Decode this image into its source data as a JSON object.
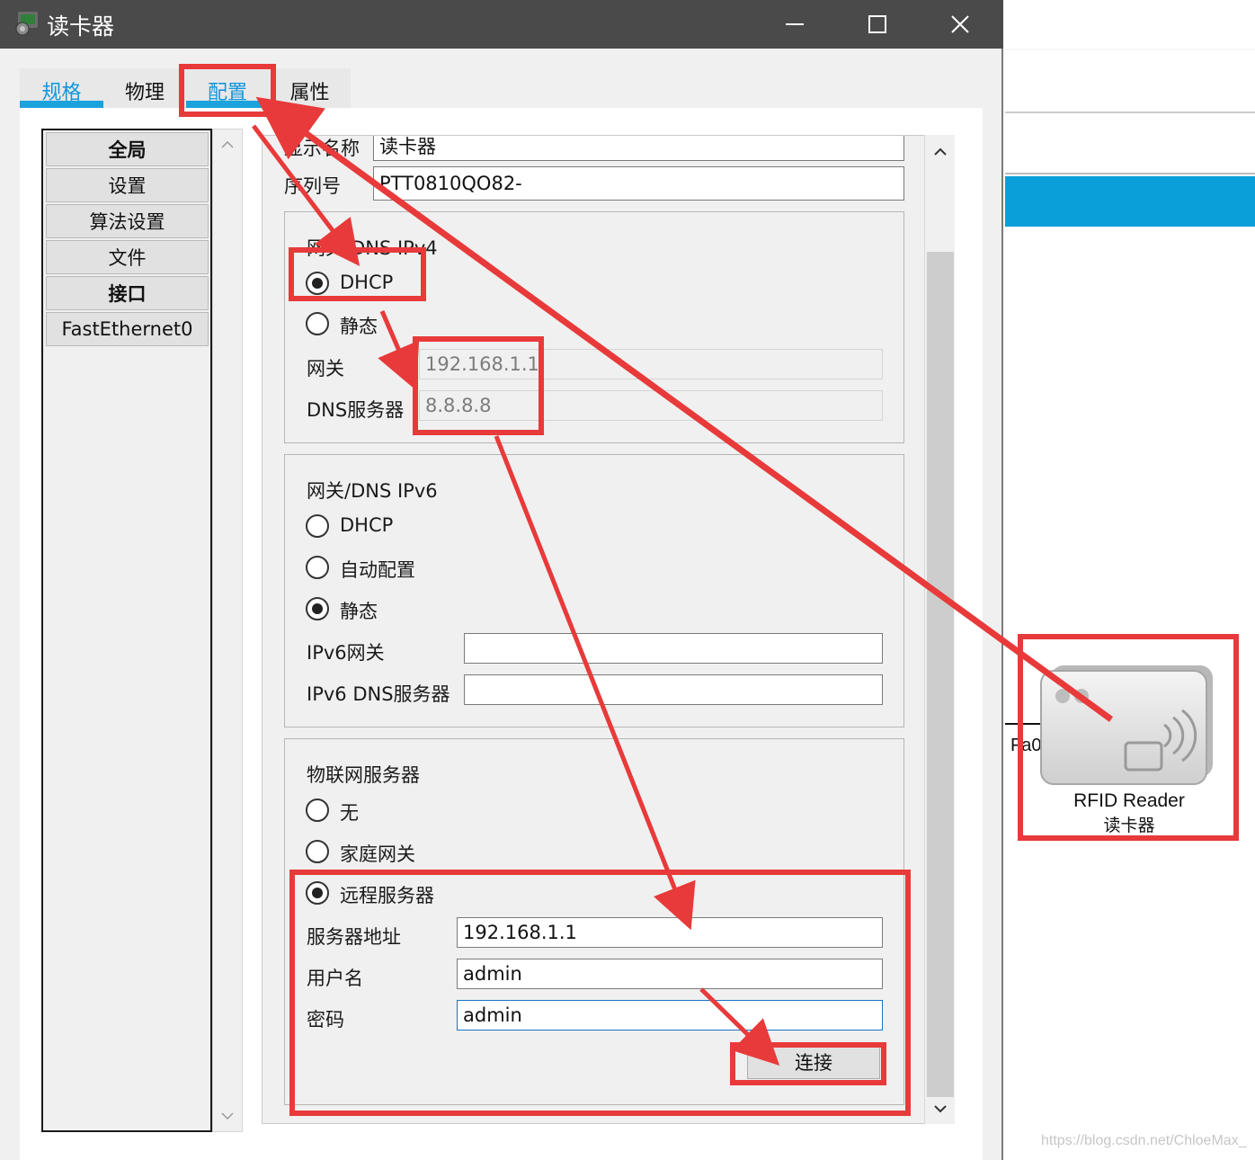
{
  "window": {
    "title": "读卡器",
    "minimize_icon": "minimize-icon",
    "maximize_icon": "maximize-icon",
    "close_icon": "close-icon"
  },
  "tabs": [
    {
      "label": "规格",
      "active": false
    },
    {
      "label": "物理",
      "active": false
    },
    {
      "label": "配置",
      "active": true
    },
    {
      "label": "属性",
      "active": false
    }
  ],
  "nav": {
    "items": [
      {
        "label": "全局",
        "bold": true
      },
      {
        "label": "设置",
        "bold": false
      },
      {
        "label": "算法设置",
        "bold": false
      },
      {
        "label": "文件",
        "bold": false
      },
      {
        "label": "接口",
        "bold": true
      },
      {
        "label": "FastEthernet0",
        "bold": false
      }
    ]
  },
  "config": {
    "display_name_label": "显示名称",
    "display_name_value": "读卡器",
    "serial_label": "序列号",
    "serial_value": "PTT0810QO82-",
    "ipv4": {
      "title": "网关/DNS IPv4",
      "dhcp_label": "DHCP",
      "static_label": "静态",
      "selected": "DHCP",
      "gateway_label": "网关",
      "gateway_value": "192.168.1.1",
      "dns_label": "DNS服务器",
      "dns_value": "8.8.8.8"
    },
    "ipv6": {
      "title": "网关/DNS IPv6",
      "dhcp_label": "DHCP",
      "auto_label": "自动配置",
      "static_label": "静态",
      "selected": "静态",
      "gateway_label": "IPv6网关",
      "gateway_value": "",
      "dns_label": "IPv6 DNS服务器",
      "dns_value": ""
    },
    "iot": {
      "title": "物联网服务器",
      "none_label": "无",
      "home_gw_label": "家庭网关",
      "remote_label": "远程服务器",
      "selected": "远程服务器",
      "server_addr_label": "服务器地址",
      "server_addr_value": "192.168.1.1",
      "username_label": "用户名",
      "username_value": "admin",
      "password_label": "密码",
      "password_value": "admin",
      "connect_label": "连接"
    }
  },
  "canvas": {
    "device_name": "RFID Reader",
    "device_subname": "读卡器",
    "port_label": "Fa0",
    "watermark": "https://blog.csdn.net/ChloeMax_"
  },
  "colors": {
    "titlebar": "#4a4a4a",
    "tab_accent": "#1aa3dc",
    "annotation": "#e83a3a",
    "canvas_band": "#0a9fd8"
  }
}
